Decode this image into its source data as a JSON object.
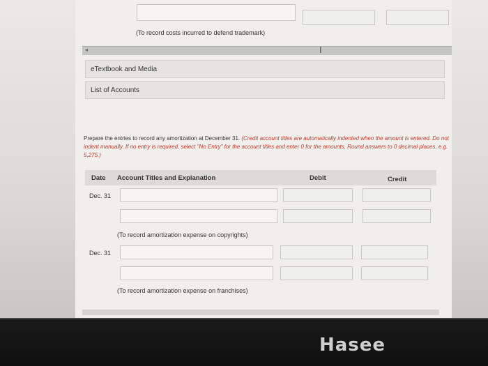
{
  "top_note": "(To record costs incurred to defend trademark)",
  "links": [
    "eTextbook and Media",
    "List of Accounts"
  ],
  "instructions": {
    "plain": "Prepare the entries to record any amortization at December 31.",
    "red": "(Credit account titles are automatically indented when the amount is entered. Do not indent manually. If no entry is required, select \"No Entry\" for the account titles and enter 0 for the amounts. Round answers to 0 decimal places, e.g. 5,275.)"
  },
  "table": {
    "headers": {
      "date": "Date",
      "account": "Account Titles and Explanation",
      "debit": "Debit",
      "credit": "Credit"
    },
    "entries": [
      {
        "date": "Dec. 31",
        "note": "(To record amortization expense on copyrights)"
      },
      {
        "date": "Dec. 31",
        "note": "(To record amortization expense on franchises)"
      }
    ]
  },
  "brand": "Hasee"
}
